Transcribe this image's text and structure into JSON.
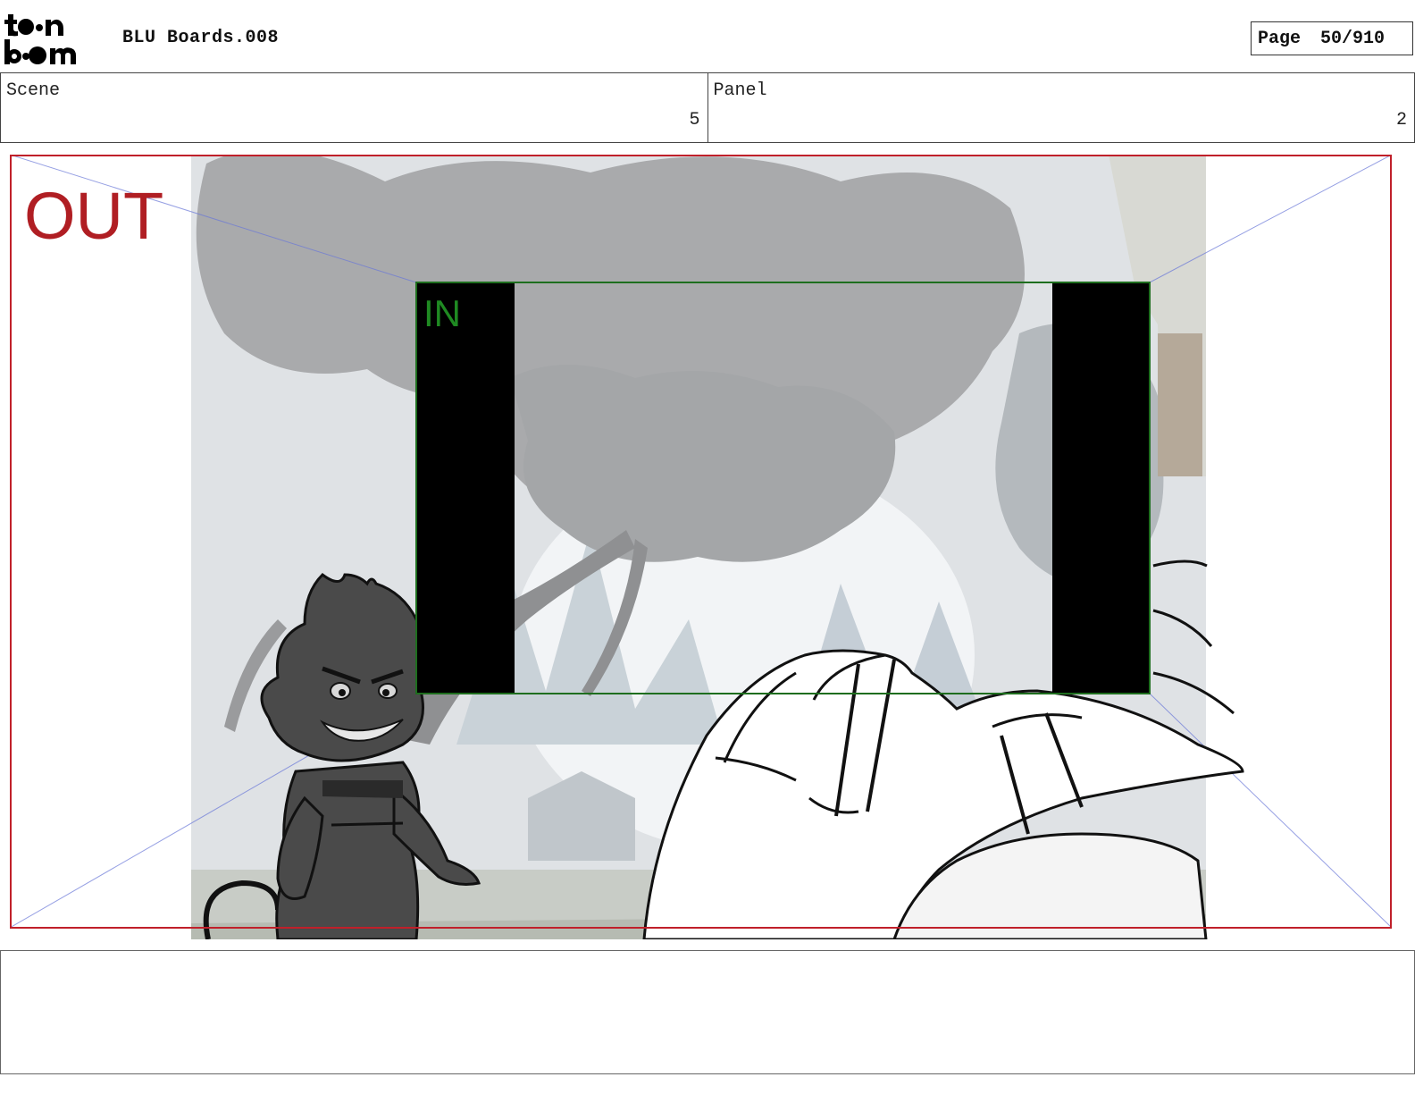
{
  "header": {
    "logo_icon": "toon-boom-logo",
    "logo_text": "toon boom",
    "title": "BLU Boards.008",
    "page_label": "Page",
    "page_value": "50/910"
  },
  "scene": {
    "label": "Scene",
    "value": "5"
  },
  "panel": {
    "label": "Panel",
    "value": "2"
  },
  "frame": {
    "out_label": "OUT",
    "in_label": "IN",
    "out_color": "#b01e23",
    "in_color": "#1f8a22"
  },
  "notes": {
    "text": ""
  }
}
